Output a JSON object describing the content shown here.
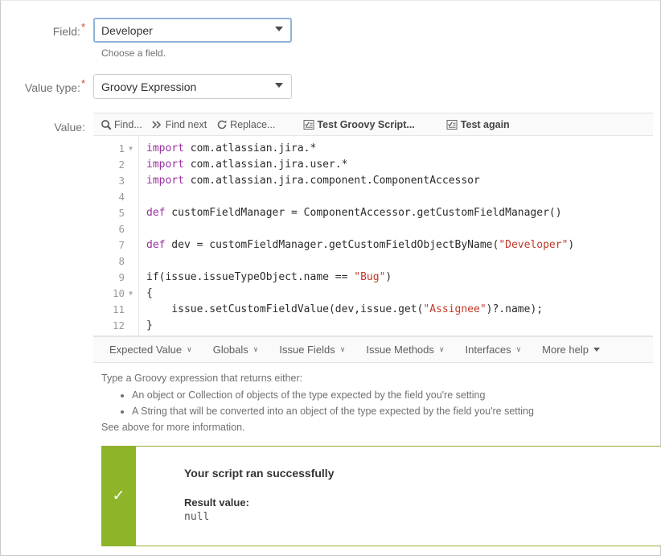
{
  "form": {
    "field": {
      "label": "Field:",
      "required": true,
      "value": "Developer",
      "options": [
        "Developer"
      ],
      "hint": "Choose a field."
    },
    "value_type": {
      "label": "Value type:",
      "required": true,
      "value": "Groovy Expression",
      "options": [
        "Groovy Expression"
      ]
    },
    "value": {
      "label": "Value:"
    }
  },
  "editor": {
    "toolbar": [
      {
        "icon": "search-icon",
        "label": "Find...",
        "bold": false
      },
      {
        "icon": "find-next-icon",
        "label": "Find next",
        "bold": false
      },
      {
        "icon": "replace-icon",
        "label": "Replace...",
        "bold": false
      },
      {
        "icon": "test-script-icon",
        "label": "Test Groovy Script...",
        "bold": true
      },
      {
        "icon": "test-script-icon",
        "label": "Test again",
        "bold": true
      }
    ],
    "lines": [
      {
        "n": "1",
        "fold": true,
        "tokens": [
          {
            "t": "import",
            "c": "kw"
          },
          {
            "t": " com.atlassian.jira.*",
            "c": ""
          }
        ]
      },
      {
        "n": "2",
        "fold": false,
        "tokens": [
          {
            "t": "import",
            "c": "kw"
          },
          {
            "t": " com.atlassian.jira.user.*",
            "c": ""
          }
        ]
      },
      {
        "n": "3",
        "fold": false,
        "tokens": [
          {
            "t": "import",
            "c": "kw"
          },
          {
            "t": " com.atlassian.jira.component.ComponentAccessor",
            "c": ""
          }
        ]
      },
      {
        "n": "4",
        "fold": false,
        "tokens": []
      },
      {
        "n": "5",
        "fold": false,
        "tokens": [
          {
            "t": "def",
            "c": "kw"
          },
          {
            "t": " customFieldManager = ComponentAccessor.getCustomFieldManager()",
            "c": ""
          }
        ]
      },
      {
        "n": "6",
        "fold": false,
        "tokens": []
      },
      {
        "n": "7",
        "fold": false,
        "tokens": [
          {
            "t": "def",
            "c": "kw"
          },
          {
            "t": " dev = customFieldManager.getCustomFieldObjectByName(",
            "c": ""
          },
          {
            "t": "\"Developer\"",
            "c": "str"
          },
          {
            "t": ")",
            "c": ""
          }
        ]
      },
      {
        "n": "8",
        "fold": false,
        "tokens": []
      },
      {
        "n": "9",
        "fold": false,
        "tokens": [
          {
            "t": "if(issue.issueTypeObject.name == ",
            "c": ""
          },
          {
            "t": "\"Bug\"",
            "c": "str"
          },
          {
            "t": ")",
            "c": ""
          }
        ]
      },
      {
        "n": "10",
        "fold": true,
        "tokens": [
          {
            "t": "{",
            "c": ""
          }
        ]
      },
      {
        "n": "11",
        "fold": false,
        "tokens": [
          {
            "t": "    issue.setCustomFieldValue(dev,issue.get(",
            "c": ""
          },
          {
            "t": "\"Assignee\"",
            "c": "str"
          },
          {
            "t": ")?.name);",
            "c": ""
          }
        ]
      },
      {
        "n": "12",
        "fold": false,
        "tokens": [
          {
            "t": "}",
            "c": ""
          }
        ]
      }
    ],
    "help_tabs": [
      {
        "label": "Expected Value",
        "indicator": "chevron-down-icon"
      },
      {
        "label": "Globals",
        "indicator": "chevron-down-icon"
      },
      {
        "label": "Issue Fields",
        "indicator": "chevron-down-icon"
      },
      {
        "label": "Issue Methods",
        "indicator": "chevron-down-icon"
      },
      {
        "label": "Interfaces",
        "indicator": "chevron-down-icon"
      },
      {
        "label": "More help",
        "indicator": "caret-down-icon"
      }
    ]
  },
  "description": {
    "intro": "Type a Groovy expression that returns either:",
    "bullets": [
      "An object or Collection of objects of the type expected by the field you're setting",
      "A String that will be converted into an object of the type expected by the field you're setting"
    ],
    "outro": "See above for more information."
  },
  "result": {
    "icon": "checkmark-icon",
    "title": "Your script ran successfully",
    "value_label": "Result value:",
    "value": "null",
    "accent_color": "#8eb52a",
    "border_color": "#9aad3b"
  }
}
